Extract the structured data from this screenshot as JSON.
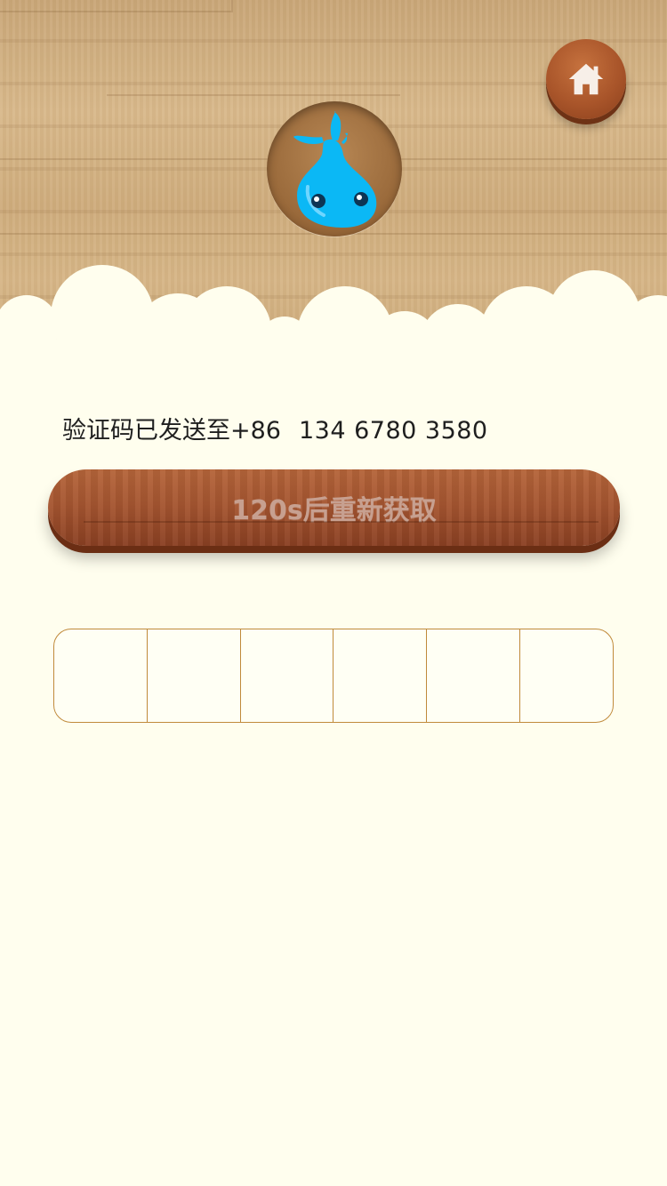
{
  "header": {
    "home_icon": "home-icon",
    "logo_icon": "water-drop-mascot-icon"
  },
  "verification": {
    "sent_label": "验证码已发送至+86",
    "phone": "134 6780 3580"
  },
  "resend_button": {
    "label": "120s后重新获取"
  },
  "code_input": {
    "digits": [
      "",
      "",
      "",
      "",
      "",
      ""
    ]
  },
  "colors": {
    "background": "#fffeee",
    "wood_button": "#a65631",
    "box_border": "#c08a3b",
    "mascot_blue": "#0bb8f5"
  }
}
